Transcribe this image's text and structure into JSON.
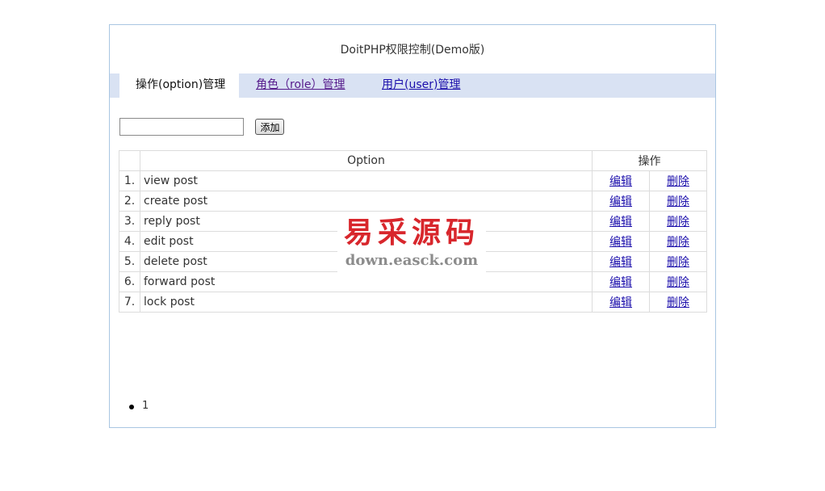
{
  "page": {
    "title": "DoitPHP权限控制(Demo版)",
    "colors": {
      "border": "#a9c6e2",
      "tabbar": "#d9e2f3",
      "link": "#1a0dab",
      "watermark": "#d8262c"
    }
  },
  "tabs": [
    {
      "label": "操作(option)管理",
      "active": true
    },
    {
      "label": "角色（role）管理",
      "active": false
    },
    {
      "label": "用户(user)管理",
      "active": false
    }
  ],
  "add_form": {
    "input_value": "",
    "button_label": "添加"
  },
  "table": {
    "headers": {
      "index": "",
      "option": "Option",
      "actions": "操作"
    },
    "action_labels": {
      "edit": "编辑",
      "delete": "删除"
    },
    "rows": [
      {
        "index": "1.",
        "option": "view post"
      },
      {
        "index": "2.",
        "option": "create post"
      },
      {
        "index": "3.",
        "option": "reply post"
      },
      {
        "index": "4.",
        "option": "edit post"
      },
      {
        "index": "5.",
        "option": "delete post"
      },
      {
        "index": "6.",
        "option": "forward post"
      },
      {
        "index": "7.",
        "option": "lock post"
      }
    ]
  },
  "pagination": {
    "pages": [
      "1"
    ]
  },
  "watermark": {
    "title": "易采源码",
    "url": "down.easck.com"
  }
}
